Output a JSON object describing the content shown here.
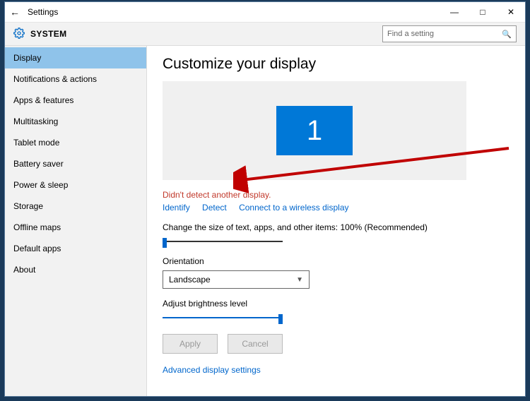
{
  "window": {
    "title": "Settings",
    "section": "SYSTEM"
  },
  "search": {
    "placeholder": "Find a setting"
  },
  "sidebar": {
    "items": [
      {
        "label": "Display",
        "selected": true
      },
      {
        "label": "Notifications & actions"
      },
      {
        "label": "Apps & features"
      },
      {
        "label": "Multitasking"
      },
      {
        "label": "Tablet mode"
      },
      {
        "label": "Battery saver"
      },
      {
        "label": "Power & sleep"
      },
      {
        "label": "Storage"
      },
      {
        "label": "Offline maps"
      },
      {
        "label": "Default apps"
      },
      {
        "label": "About"
      }
    ]
  },
  "main": {
    "title": "Customize your display",
    "monitor_number": "1",
    "status_message": "Didn't detect another display.",
    "links": {
      "identify": "Identify",
      "detect": "Detect",
      "connect": "Connect to a wireless display"
    },
    "text_size": {
      "label": "Change the size of text, apps, and other items: 100% (Recommended)",
      "value_percent": 0
    },
    "orientation": {
      "label": "Orientation",
      "value": "Landscape"
    },
    "brightness": {
      "label": "Adjust brightness level",
      "value_percent": 100
    },
    "buttons": {
      "apply": "Apply",
      "cancel": "Cancel"
    },
    "advanced_link": "Advanced display settings"
  }
}
